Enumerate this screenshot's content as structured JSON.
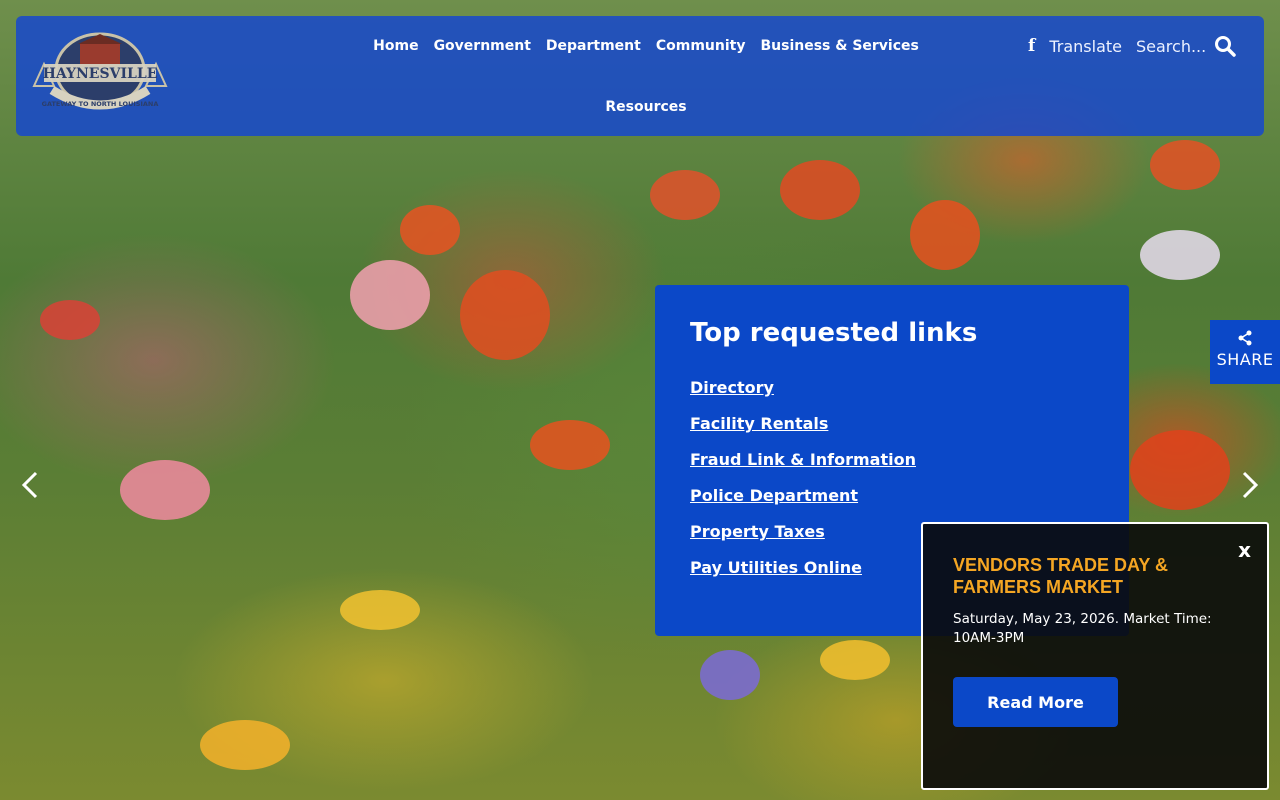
{
  "header": {
    "logo_text": "HAYNESVILLE",
    "logo_tagline": "GATEWAY TO NORTH LOUISIANA",
    "nav": [
      {
        "label": "Home"
      },
      {
        "label": "Government"
      },
      {
        "label": "Department"
      },
      {
        "label": "Community"
      },
      {
        "label": "Business & Services"
      },
      {
        "label": "Resources"
      }
    ],
    "facebook_icon": "facebook-icon",
    "translate_label": "Translate",
    "search_placeholder": "Search...",
    "search_icon": "search-icon"
  },
  "links_panel": {
    "title": "Top requested links",
    "items": [
      {
        "label": "Directory"
      },
      {
        "label": "Facility Rentals"
      },
      {
        "label": "Fraud Link & Information"
      },
      {
        "label": "Police Department"
      },
      {
        "label": "Property Taxes"
      },
      {
        "label": "Pay Utilities Online"
      }
    ]
  },
  "share": {
    "label": "SHARE",
    "icon": "share-icon"
  },
  "slider": {
    "prev_icon": "chevron-left-icon",
    "next_icon": "chevron-right-icon"
  },
  "popup": {
    "close_label": "x",
    "title": "VENDORS TRADE DAY & FARMERS MARKET",
    "description": "Saturday, May 23, 2026.  Market Time: 10AM-3PM",
    "button_label": "Read More"
  },
  "colors": {
    "header_bg": "#1446d2",
    "panel_bg": "#0b48c8",
    "popup_title": "#f5a623",
    "popup_bg": "#0a0a0a"
  }
}
